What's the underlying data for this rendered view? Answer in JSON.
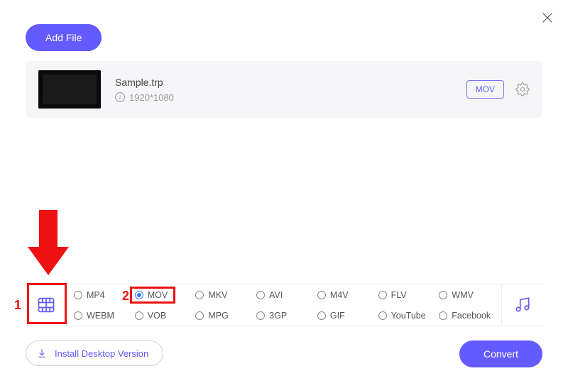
{
  "header": {
    "add_file_label": "Add File"
  },
  "file": {
    "name": "Sample.trp",
    "resolution": "1920*1080",
    "format_badge": "MOV"
  },
  "formats": {
    "row1": [
      "MP4",
      "MOV",
      "MKV",
      "AVI",
      "M4V",
      "FLV",
      "WMV"
    ],
    "row2": [
      "WEBM",
      "VOB",
      "MPG",
      "3GP",
      "GIF",
      "YouTube",
      "Facebook"
    ],
    "selected": "MOV"
  },
  "footer": {
    "install_label": "Install Desktop Version",
    "convert_label": "Convert"
  },
  "annotations": {
    "label1": "1",
    "label2": "2"
  }
}
